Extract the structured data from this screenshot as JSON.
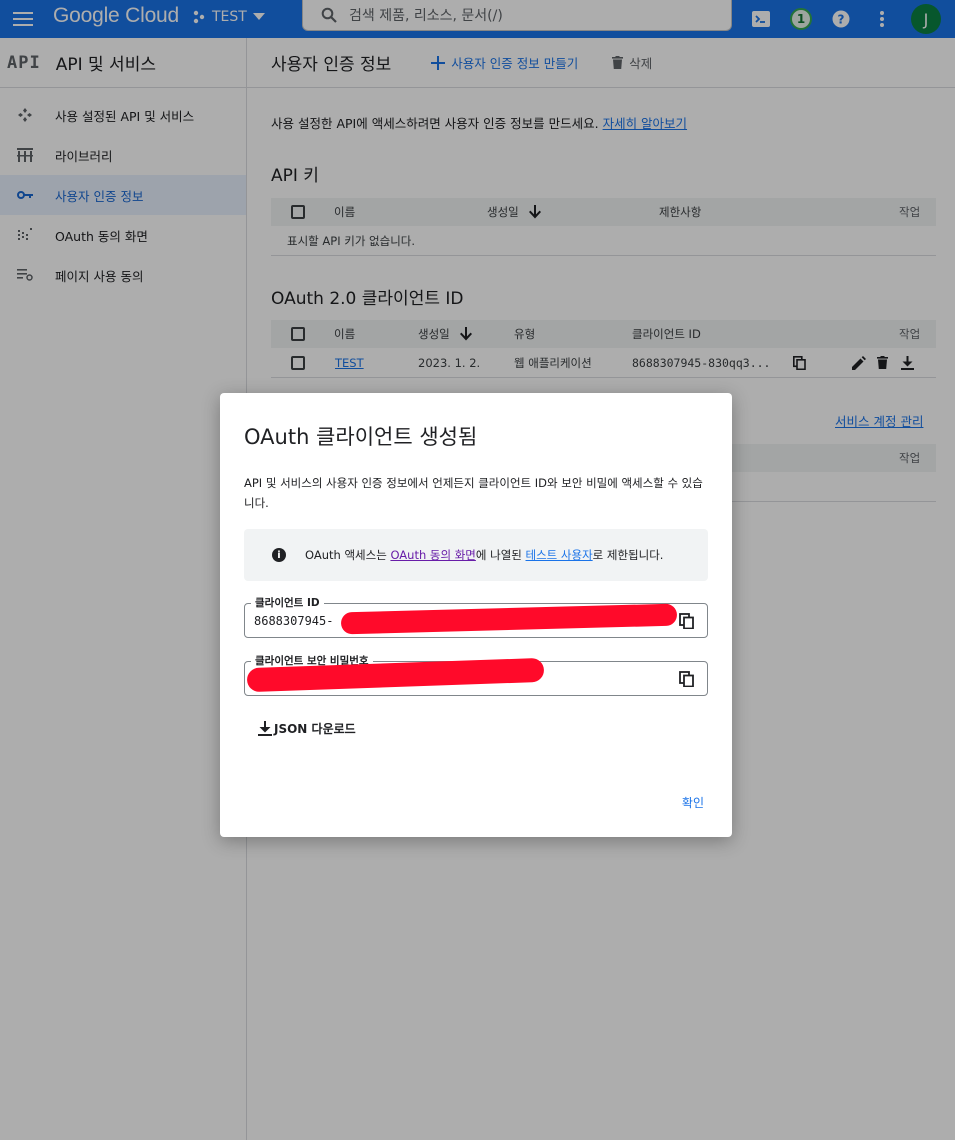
{
  "topbar": {
    "logo": "Google Cloud",
    "project": "TEST",
    "search_placeholder": "검색   제품, 리소스, 문서(/)",
    "notification_count": "1",
    "avatar_initial": "J"
  },
  "sidebar": {
    "badge": "API",
    "title": "API 및 서비스",
    "items": [
      {
        "label": "사용 설정된 API 및 서비스",
        "icon": "apis-icon"
      },
      {
        "label": "라이브러리",
        "icon": "library-icon"
      },
      {
        "label": "사용자 인증 정보",
        "icon": "key-icon"
      },
      {
        "label": "OAuth 동의 화면",
        "icon": "consent-icon"
      },
      {
        "label": "페이지 사용 동의",
        "icon": "page-settings-icon"
      }
    ]
  },
  "main": {
    "title": "사용자 인증 정보",
    "create_label": "사용자 인증 정보 만들기",
    "delete_label": "삭제",
    "intro_text": "사용 설정한 API에 액세스하려면 사용자 인증 정보를 만드세요.",
    "intro_link": "자세히 알아보기",
    "api_keys": {
      "title": "API 키",
      "headers": {
        "name": "이름",
        "created": "생성일",
        "restrictions": "제한사항",
        "actions": "작업"
      },
      "empty": "표시할 API 키가 없습니다."
    },
    "oauth": {
      "title": "OAuth 2.0 클라이언트 ID",
      "headers": {
        "name": "이름",
        "created": "생성일",
        "type": "유형",
        "client_id": "클라이언트 ID",
        "actions": "작업"
      },
      "rows": [
        {
          "name": "TEST",
          "created": "2023. 1. 2.",
          "type": "웹 애플리케이션",
          "client_id": "8688307945-830qq3..."
        }
      ]
    },
    "service_accounts": {
      "manage_link": "서비스 계정 관리",
      "actions": "작업"
    }
  },
  "dialog": {
    "title": "OAuth 클라이언트 생성됨",
    "description": "API 및 서비스의 사용자 인증 정보에서 언제든지 클라이언트 ID와 보안 비밀에 액세스할 수 있습니다.",
    "info_prefix": "OAuth 액세스는 ",
    "info_link1": "OAuth 동의 화면",
    "info_middle": "에 나열된 ",
    "info_link2": "테스트 사용자",
    "info_suffix": "로 제한됩니다.",
    "client_id_label": "클라이언트 ID",
    "client_id_value": "8688307945-",
    "client_secret_label": "클라이언트 보안 비밀번호",
    "client_secret_value": "",
    "json_download": "JSON 다운로드",
    "ok_label": "확인"
  },
  "colors": {
    "accent": "#1a73e8",
    "redaction": "#ff0a2a"
  }
}
